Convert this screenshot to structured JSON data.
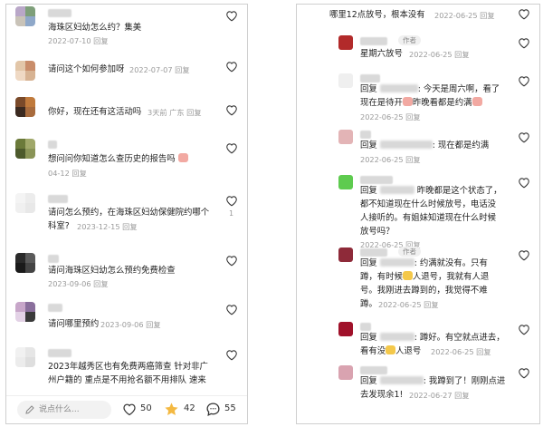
{
  "left": {
    "comments": [
      {
        "text": "海珠区妇幼怎么约？集美",
        "meta": "2022-07-10  回复"
      },
      {
        "text": "请问这个如何参加呀",
        "meta": "2022-07-07  回复"
      },
      {
        "text": "你好，现在还有这活动吗",
        "meta": "3天前  广东  回复"
      },
      {
        "text": "想问问你知道怎么查历史的报告吗",
        "meta": "04-12  回复"
      },
      {
        "text1": "请问怎么预约，在海珠区妇幼保健院约哪个",
        "text2": "科室?",
        "meta": "2023-12-15  回复",
        "likes": "1"
      },
      {
        "text": "请问海珠区妇幼怎么预约免费检查",
        "meta": "2023-09-06  回复"
      },
      {
        "text": "请问哪里预约",
        "meta": "2023-09-06  回复"
      },
      {
        "text1": "2023年越秀区也有免费两癌筛查 针对非广",
        "text2": "州户籍的  重点是不用抢名额不用排队  速来"
      }
    ],
    "bottom_bar": {
      "input_placeholder": "说点什么...",
      "likes": "50",
      "stars": "42",
      "comments": "55"
    }
  },
  "right": {
    "top": {
      "text": "哪里12点放号，根本没有",
      "meta": "2022-06-25  回复"
    },
    "author_badge": "作者",
    "replies": [
      {
        "text": "星期六放号",
        "meta": "2022-06-25  回复"
      },
      {
        "reply_prefix": "回复",
        "line1_tail": ": 今天是周六啊，看了",
        "line2": "现在是待开",
        "line2b": "昨晚看都是约满",
        "meta": "2022-06-25  回复"
      },
      {
        "reply_prefix": "回复",
        "line1_tail": ": 现在都是约满",
        "meta": "2022-06-25  回复"
      },
      {
        "reply_prefix": "回复",
        "line1_tail": "昨晚都是这个状态了，",
        "line2": "都不知道现在什么时候放号，电话没",
        "line3": "人接听的。有姐妹知道现在什么时候",
        "line4": "放号吗？",
        "meta": "2022-06-25  回复"
      },
      {
        "reply_prefix": "回复",
        "line1_tail": ": 约满就没有。只有",
        "line2a": "蹲，有时候",
        "line2b": "人退号，我就有人退",
        "line3": "号。我刚进去蹲到的，我觉得不难",
        "line4": "蹲。",
        "meta": "2022-06-25  回复"
      },
      {
        "reply_prefix": "回复",
        "line1_tail": ": 蹲好。有空就点进去，",
        "line2a": "看有没",
        "line2b": "人退号",
        "meta": "2022-06-25  回复"
      },
      {
        "reply_prefix": "回复",
        "line1_tail": ": 我蹲到了！刚刚点进",
        "line2": "去发现余1!",
        "meta": "2022-06-27  回复"
      }
    ]
  },
  "colors": {
    "accent_star": "#f4b942",
    "meta_gray": "#9a9a9a"
  }
}
